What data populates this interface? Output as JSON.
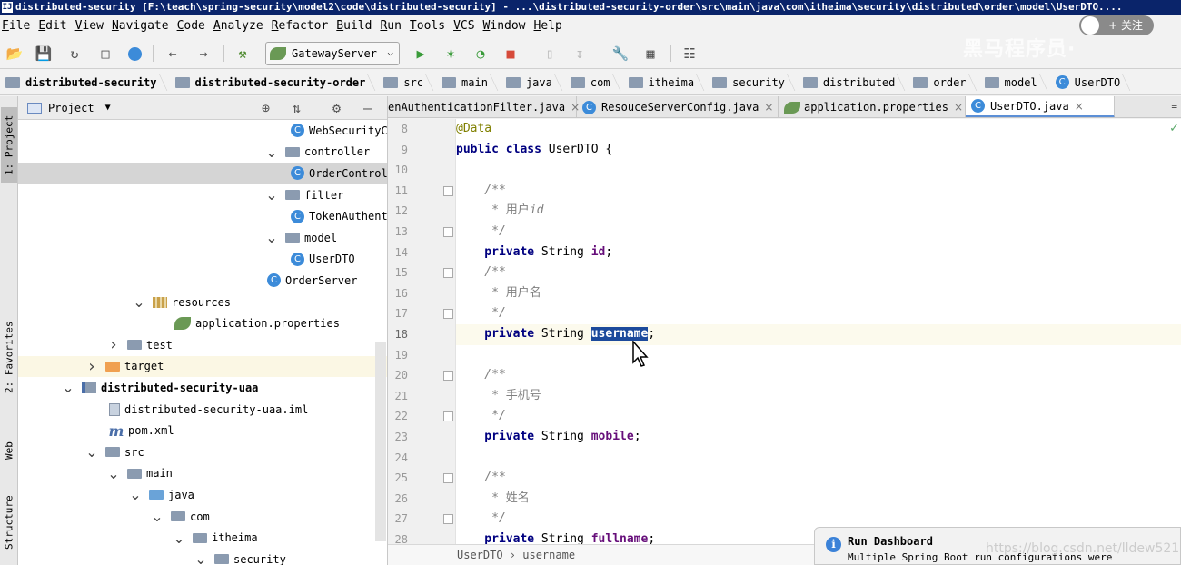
{
  "window": {
    "title": "distributed-security [F:\\teach\\spring-security\\model2\\code\\distributed-security] - ...\\distributed-security-order\\src\\main\\java\\com\\itheima\\security\\distributed\\order\\model\\UserDTO....",
    "follow_label": "+ 关注",
    "watermark": "黑马程序员·"
  },
  "menu": [
    "File",
    "Edit",
    "View",
    "Navigate",
    "Code",
    "Analyze",
    "Refactor",
    "Build",
    "Run",
    "Tools",
    "VCS",
    "Window",
    "Help"
  ],
  "toolbar": {
    "run_config": "GatewayServer"
  },
  "breadcrumb": [
    "distributed-security",
    "distributed-security-order",
    "src",
    "main",
    "java",
    "com",
    "itheima",
    "security",
    "distributed",
    "order",
    "model",
    "UserDTO"
  ],
  "left_strip": [
    "1: Project",
    "2: Favorites",
    "Web",
    "Structure"
  ],
  "project_panel": {
    "title": "Project",
    "rows": [
      {
        "label": "WebSecurityCo",
        "icon": "class"
      },
      {
        "label": "controller",
        "icon": "folder",
        "arrow": "v"
      },
      {
        "label": "OrderControll",
        "icon": "class"
      },
      {
        "label": "filter",
        "icon": "folder",
        "arrow": "v"
      },
      {
        "label": "TokenAuthenti",
        "icon": "class"
      },
      {
        "label": "model",
        "icon": "folder",
        "arrow": "v"
      },
      {
        "label": "UserDTO",
        "icon": "class"
      },
      {
        "label": "OrderServer",
        "icon": "class"
      },
      {
        "label": "resources",
        "icon": "res",
        "arrow": "v"
      },
      {
        "label": "application.properties",
        "icon": "leaf"
      },
      {
        "label": "test",
        "icon": "folder",
        "arrow": ">"
      },
      {
        "label": "target",
        "icon": "folder-orange",
        "arrow": ">"
      },
      {
        "label": "distributed-security-uaa",
        "icon": "module",
        "arrow": "v"
      },
      {
        "label": "distributed-security-uaa.iml",
        "icon": "iml"
      },
      {
        "label": "pom.xml",
        "icon": "maven"
      },
      {
        "label": "src",
        "icon": "folder",
        "arrow": "v"
      },
      {
        "label": "main",
        "icon": "folder",
        "arrow": "v"
      },
      {
        "label": "java",
        "icon": "folder-blue",
        "arrow": "v"
      },
      {
        "label": "com",
        "icon": "folder",
        "arrow": "v"
      },
      {
        "label": "itheima",
        "icon": "folder",
        "arrow": "v"
      },
      {
        "label": "security",
        "icon": "folder",
        "arrow": "v"
      }
    ]
  },
  "tabs": [
    {
      "label": "enAuthenticationFilter.java",
      "icon": "none",
      "close": "×"
    },
    {
      "label": "ResouceServerConfig.java",
      "icon": "class",
      "close": "×"
    },
    {
      "label": "application.properties",
      "icon": "leaf",
      "close": "×"
    },
    {
      "label": "UserDTO.java",
      "icon": "class",
      "close": "×"
    }
  ],
  "editor": {
    "line_numbers": [
      "8",
      "9",
      "10",
      "11",
      "12",
      "13",
      "14",
      "15",
      "16",
      "17",
      "18",
      "19",
      "20",
      "21",
      "22",
      "23",
      "24",
      "25",
      "26",
      "27",
      "28"
    ],
    "lines": [
      {
        "ann": "@Data"
      },
      {
        "kw": "public class ",
        "text": "UserDTO {"
      },
      {},
      {
        "cm": "    /**"
      },
      {
        "cm_star": "     * ",
        "cm_cn": "用户",
        "cm_tail": "id"
      },
      {
        "cm": "     */"
      },
      {
        "kw": "    private ",
        "text": "String ",
        "field": "id",
        "end": ";"
      },
      {
        "cm": "    /**"
      },
      {
        "cm_star": "     * ",
        "cm_cn": "用户名"
      },
      {
        "cm": "     */"
      },
      {
        "kw": "    private ",
        "text": "String ",
        "sel": "username",
        "end": ";"
      },
      {},
      {
        "cm": "    /**"
      },
      {
        "cm_star": "     * ",
        "cm_cn": "手机号"
      },
      {
        "cm": "     */"
      },
      {
        "kw": "    private ",
        "text": "String ",
        "field": "mobile",
        "end": ";"
      },
      {},
      {
        "cm": "    /**"
      },
      {
        "cm_star": "     * ",
        "cm_cn": "姓名"
      },
      {
        "cm": "     */"
      },
      {
        "kw": "    private ",
        "text": "String ",
        "field": "fullname",
        "end": ";"
      }
    ],
    "breadcrumb": "UserDTO  ›  username"
  },
  "notification": {
    "title": "Run Dashboard",
    "message": "Multiple Spring Boot run configurations were"
  },
  "csdn_watermark": "https://blog.csdn.net/lldew521",
  "colors": {
    "title_bar": "#0a246a",
    "selection": "#1c4a9c",
    "keyword": "#000080",
    "field": "#660e7a",
    "annotation": "#808000",
    "comment": "#808080"
  }
}
